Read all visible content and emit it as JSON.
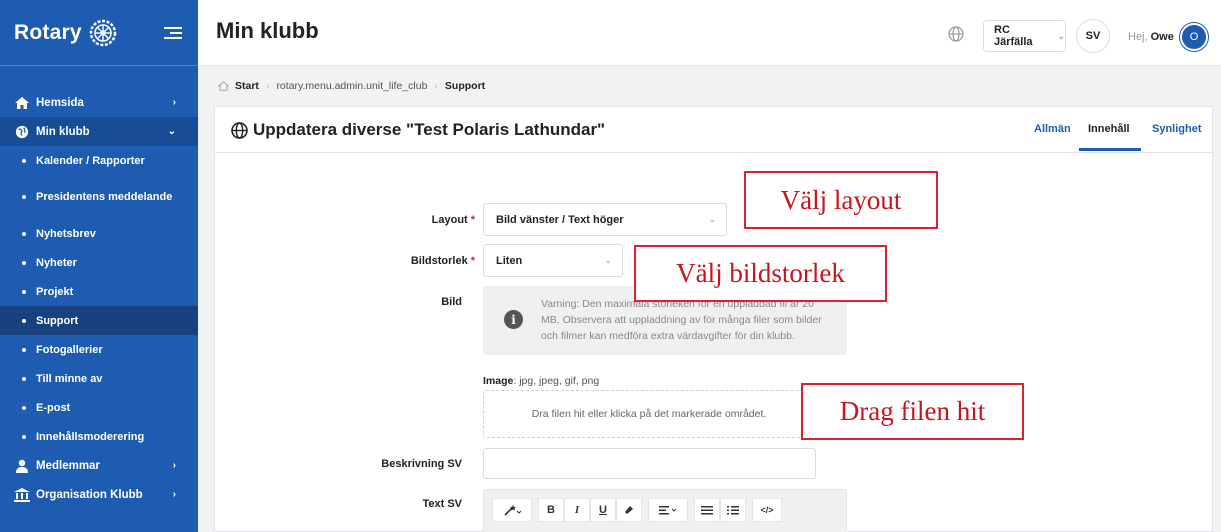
{
  "sidebar": {
    "brand": "Rotary",
    "nav": [
      {
        "label": "Hemsida",
        "icon": "home-icon"
      },
      {
        "label": "Min klubb",
        "icon": "globe-icon"
      }
    ],
    "sub_items": [
      "Kalender / Rapporter",
      "Presidentens meddelande",
      "Nyhetsbrev",
      "Nyheter",
      "Projekt",
      "Support",
      "Fotogallerier",
      "Till minne av",
      "E-post",
      "Innehållsmoderering"
    ],
    "nav_bottom": [
      {
        "label": "Medlemmar",
        "icon": "user-icon"
      },
      {
        "label": "Organisation Klubb",
        "icon": "institution-icon"
      }
    ],
    "active_item": "Support"
  },
  "header": {
    "title": "Min klubb",
    "club": "RC Järfälla",
    "language": "SV",
    "greeting": "Hej,",
    "user": "Owe",
    "avatar_initial": "O"
  },
  "breadcrumb": {
    "start": "Start",
    "middle": "rotary.menu.admin.unit_life_club",
    "current": "Support"
  },
  "card": {
    "title": "Uppdatera diverse \"Test Polaris Lathundar\"",
    "tabs": [
      "Allmän",
      "Innehåll",
      "Synlighet"
    ],
    "active_tab": "Innehåll"
  },
  "form": {
    "layout_label": "Layout",
    "layout_value": "Bild vänster / Text höger",
    "size_label": "Bildstorlek",
    "size_value": "Liten",
    "image_label": "Bild",
    "warning": "Varning: Den maximala storleken för en uppladdad fil är 20 MB. Observera att uppladdning av för många filer som bilder och filmer kan medföra extra värdavgifter för din klubb.",
    "image_types_label": "Image",
    "image_types": ": jpg, jpeg, gif, png",
    "dropzone_text": "Dra filen hit eller klicka på det markerade området.",
    "description_label": "Beskrivning SV",
    "text_label": "Text SV",
    "required_mark": "*"
  },
  "toolbar": {
    "bold": "B",
    "italic": "I",
    "underline": "U",
    "code": "</>"
  },
  "annotations": {
    "layout": "Välj layout",
    "size": "Välj bildstorlek",
    "drag": "Drag filen hit"
  },
  "colors": {
    "sidebar": "#1d5cb0",
    "active": "#17427d",
    "annotation": "#e0202a"
  }
}
